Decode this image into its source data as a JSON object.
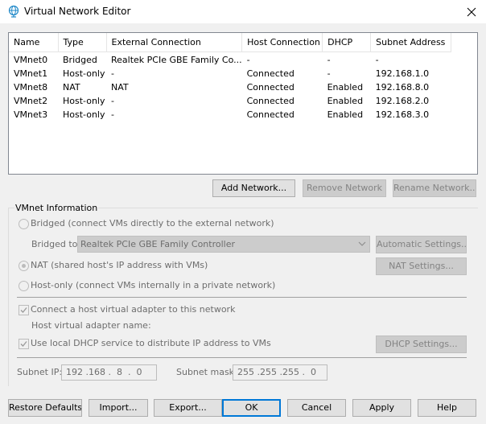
{
  "window": {
    "title": "Virtual Network Editor"
  },
  "network_list": {
    "columns": [
      "Name",
      "Type",
      "External Connection",
      "Host Connection",
      "DHCP",
      "Subnet Address"
    ],
    "rows": [
      [
        "VMnet0",
        "Bridged",
        "Realtek PCIe GBE Family Co...",
        "-",
        "-",
        "-"
      ],
      [
        "VMnet1",
        "Host-only",
        "-",
        "Connected",
        "-",
        "192.168.1.0"
      ],
      [
        "VMnet8",
        "NAT",
        "NAT",
        "Connected",
        "Enabled",
        "192.168.8.0"
      ],
      [
        "VMnet2",
        "Host-only",
        "-",
        "Connected",
        "Enabled",
        "192.168.2.0"
      ],
      [
        "VMnet3",
        "Host-only",
        "-",
        "Connected",
        "Enabled",
        "192.168.3.0"
      ]
    ]
  },
  "network_buttons": {
    "add": "Add Network...",
    "remove": "Remove Network",
    "rename": "Rename Network..."
  },
  "vmnet_info": {
    "group_label": "VMnet Information",
    "bridged_label": "Bridged (connect VMs directly to the external network)",
    "bridged_to_label": "Bridged to:",
    "bridged_to_value": "Realtek PCIe GBE Family Controller",
    "auto_settings": "Automatic Settings...",
    "nat_label": "NAT (shared host's IP address with VMs)",
    "nat_settings": "NAT Settings...",
    "hostonly_label": "Host-only (connect VMs internally in a private network)",
    "connect_adapter_label": "Connect a host virtual adapter to this network",
    "adapter_name_label": "Host virtual adapter name:",
    "dhcp_label": "Use local DHCP service to distribute IP address to VMs",
    "dhcp_settings": "DHCP Settings...",
    "subnet_ip_label": "Subnet IP:",
    "subnet_ip_value": "192 .168 .  8  .  0",
    "subnet_mask_label": "Subnet mask:",
    "subnet_mask_value": "255 .255 .255 .  0",
    "selected_mode": "nat",
    "connect_adapter_checked": true,
    "dhcp_checked": true
  },
  "footer": {
    "restore": "Restore Defaults",
    "import": "Import...",
    "export": "Export...",
    "ok": "OK",
    "cancel": "Cancel",
    "apply": "Apply",
    "help": "Help"
  },
  "icons": {
    "app": "globe-network-icon",
    "close": "close-icon",
    "chevron": "chevron-down-icon",
    "check": "checkmark-icon"
  },
  "colors": {
    "accent": "#0078d7",
    "app_icon": "#1e88c8",
    "disabled_text": "#6d6d6d"
  }
}
